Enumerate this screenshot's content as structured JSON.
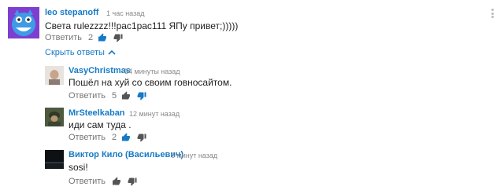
{
  "comments": [
    {
      "author": "leo stepanoff",
      "time": "1 час назад",
      "text": "Света rulezzzz!!!pac1pac111 ЯПу привет;)))))",
      "reply_label": "Ответить",
      "likes": "2",
      "author_color": "#167ac6"
    }
  ],
  "toggle_replies_label": "Скрыть ответы",
  "replies": [
    {
      "author": "VasyChristmas",
      "time": "54 минуты назад",
      "text": "Пошёл на хуй со своим говносайтом.",
      "reply_label": "Ответить",
      "likes": "5",
      "author_color": "#167ac6"
    },
    {
      "author": "MrSteelkaban",
      "time": "12 минут назад",
      "text": "иди сам туда .",
      "reply_label": "Ответить",
      "likes": "2",
      "author_color": "#167ac6"
    },
    {
      "author": "Виктор Кило (Васильевич)",
      "time": "6 минут назад",
      "text": "sosi!",
      "reply_label": "Ответить",
      "likes": "",
      "author_color": "#167ac6"
    }
  ],
  "colors": {
    "link": "#167ac6",
    "like_active": "#167ac6",
    "text_secondary": "#767676"
  },
  "icons": {
    "like": "thumbs-up-icon",
    "dislike": "thumbs-down-icon",
    "menu": "more-vert-icon",
    "chevron": "chevron-up-icon"
  }
}
